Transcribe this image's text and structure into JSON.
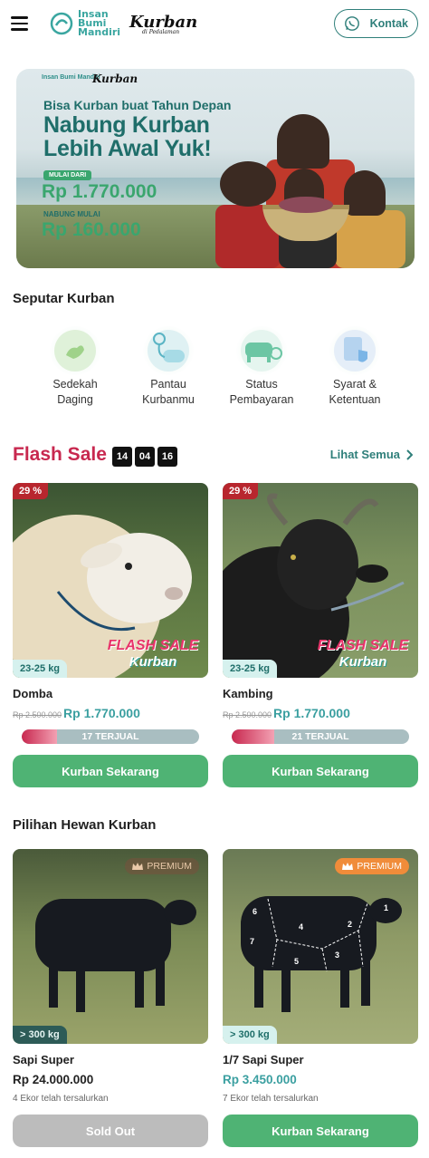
{
  "header": {
    "brand_line1": "Insan",
    "brand_line2": "Bumi",
    "brand_line3": "Mandiri",
    "brand2": "Kurban",
    "brand2_sub": "di Pedalaman",
    "contact_label": "Kontak"
  },
  "banner": {
    "headline_small": "Bisa Kurban buat Tahun Depan",
    "headline_big1": "Nabung Kurban",
    "headline_big2": "Lebih Awal Yuk!",
    "label_from": "MULAI DARI",
    "price_from": "Rp 1.770.000",
    "label_save": "NABUNG MULAI",
    "price_save": "Rp 160.000",
    "mini_logo1": "Insan Bumi Mandiri",
    "mini_logo2": "Kurban"
  },
  "seputar": {
    "title": "Seputar Kurban",
    "items": [
      {
        "label1": "Sedekah",
        "label2": "Daging"
      },
      {
        "label1": "Pantau",
        "label2": "Kurbanmu"
      },
      {
        "label1": "Status",
        "label2": "Pembayaran"
      },
      {
        "label1": "Syarat &",
        "label2": "Ketentuan"
      }
    ]
  },
  "flash": {
    "title": "Flash Sale",
    "timer": [
      "14",
      "04",
      "16"
    ],
    "see_all": "Lihat Semua",
    "badge_line1": "FLASH SALE",
    "badge_line2": "Kurban",
    "items": [
      {
        "discount": "29 %",
        "weight": "23-25 kg",
        "name": "Domba",
        "old_price": "Rp 2.500.000",
        "price": "Rp 1.770.000",
        "sold": "17 TERJUAL",
        "progress": 0.2,
        "cta": "Kurban Sekarang"
      },
      {
        "discount": "29 %",
        "weight": "23-25 kg",
        "name": "Kambing",
        "old_price": "Rp 2.500.000",
        "price": "Rp 1.770.000",
        "sold": "21 TERJUAL",
        "progress": 0.24,
        "cta": "Kurban Sekarang"
      }
    ]
  },
  "pilihan": {
    "title": "Pilihan Hewan Kurban",
    "items": [
      {
        "badge": "PREMIUM",
        "weight": "> 300 kg",
        "name": "Sapi Super",
        "price": "Rp 24.000.000",
        "sold": "4 Ekor telah tersalurkan",
        "cta": "Sold Out"
      },
      {
        "badge": "PREMIUM",
        "weight": "> 300 kg",
        "name": "1/7 Sapi Super",
        "price": "Rp 3.450.000",
        "sold": "7 Ekor telah tersalurkan",
        "cta": "Kurban Sekarang",
        "cut_labels": [
          "1",
          "2",
          "3",
          "4",
          "5",
          "6",
          "7"
        ]
      }
    ]
  },
  "colors": {
    "accent": "#2f7f7a",
    "flash": "#c8284f",
    "green": "#4fb374",
    "price": "#3a9fa0"
  }
}
